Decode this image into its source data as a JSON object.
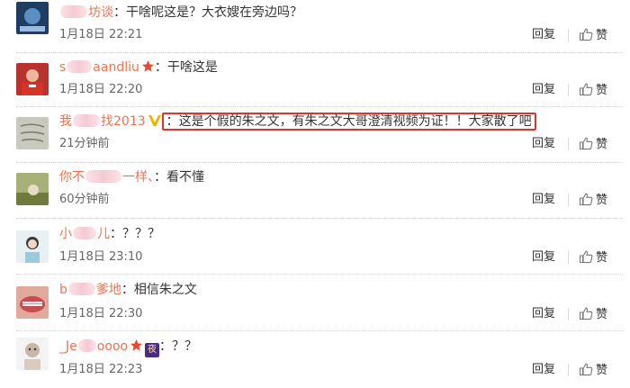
{
  "comments": [
    {
      "user_pre": "",
      "user_post": "坊谈",
      "text": "：干啥呢这是？大衣嫂在旁边吗？",
      "time": "1月18日 22:21",
      "reply": "回复",
      "like": "赞",
      "badges": []
    },
    {
      "user_pre": "s",
      "user_post": "aandliu",
      "text": "：干啥这是",
      "time": "1月18日 22:20",
      "reply": "回复",
      "like": "赞",
      "badges": [
        "star"
      ]
    },
    {
      "user_pre": "我",
      "user_post": "找2013",
      "text": "：这是个假的朱之文，有朱之文大哥澄清视频为证！！大家散了吧",
      "time": "21分钟前",
      "reply": "回复",
      "like": "赞",
      "badges": [
        "vip"
      ]
    },
    {
      "user_pre": "你不",
      "user_post": "一样、",
      "text": "：看不懂",
      "time": "60分钟前",
      "reply": "回复",
      "like": "赞",
      "badges": []
    },
    {
      "user_pre": "小",
      "user_post": "儿",
      "text": "：？？？",
      "time": "1月18日 23:10",
      "reply": "回复",
      "like": "赞",
      "badges": []
    },
    {
      "user_pre": "b",
      "user_post": "爹地",
      "text": "：相信朱之文",
      "time": "1月18日 22:30",
      "reply": "回复",
      "like": "赞",
      "badges": []
    },
    {
      "user_pre": "_Je",
      "user_post": "oooo",
      "text": "：？？",
      "time": "1月18日 22:23",
      "reply": "回复",
      "like": "赞",
      "badges": [
        "star",
        "night"
      ]
    }
  ],
  "badge_labels": {
    "night": "夜"
  },
  "colors": {
    "username": "#eb7350",
    "highlight_border": "#e0322f",
    "star": "#e8482d",
    "vip": "#f0b400"
  },
  "icons": {
    "like": "thumbs-up-icon",
    "star": "star-badge-icon",
    "vip": "vip-badge-icon",
    "night": "night-badge-icon"
  }
}
